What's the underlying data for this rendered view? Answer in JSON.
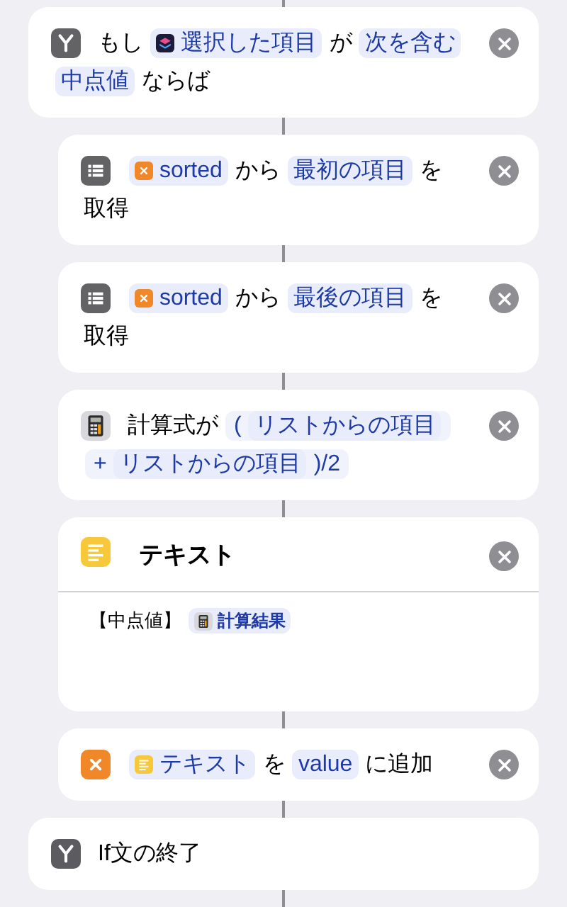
{
  "actions": [
    {
      "kind": "if",
      "removable": true,
      "parts": [
        {
          "kind": "text",
          "text": "もし"
        },
        {
          "kind": "app-token",
          "text": "選択した項目"
        },
        {
          "kind": "text",
          "text": "が"
        },
        {
          "kind": "token",
          "text": "次を含む"
        },
        {
          "kind": "token",
          "text": "中点値"
        },
        {
          "kind": "text",
          "text": "ならば"
        }
      ],
      "children": [
        {
          "kind": "list",
          "removable": true,
          "parts": [
            {
              "kind": "variable-token",
              "text": "sorted"
            },
            {
              "kind": "text",
              "text": "から"
            },
            {
              "kind": "token",
              "text": "最初の項目"
            },
            {
              "kind": "text",
              "text": "を"
            },
            {
              "kind": "text",
              "text": "取得"
            }
          ]
        },
        {
          "kind": "list",
          "removable": true,
          "parts": [
            {
              "kind": "variable-token",
              "text": "sorted"
            },
            {
              "kind": "text",
              "text": "から"
            },
            {
              "kind": "token",
              "text": "最後の項目"
            },
            {
              "kind": "text",
              "text": "を"
            },
            {
              "kind": "text",
              "text": "取得"
            }
          ]
        },
        {
          "kind": "calc",
          "removable": true,
          "parts": [
            {
              "kind": "text",
              "text": "計算式が"
            },
            {
              "kind": "expression",
              "parts": [
                {
                  "kind": "text",
                  "text": "("
                },
                {
                  "kind": "token",
                  "text": "リストからの項目"
                },
                {
                  "kind": "text",
                  "text": "+"
                },
                {
                  "kind": "token",
                  "text": "リストからの項目"
                },
                {
                  "kind": "text",
                  "text": ")/2"
                }
              ]
            }
          ]
        },
        {
          "kind": "text",
          "removable": true,
          "parts": [
            {
              "kind": "text",
              "text": "テキスト"
            }
          ],
          "body": [
            {
              "kind": "text",
              "text": "【中点値】"
            },
            {
              "kind": "calc-token",
              "text": "計算結果"
            }
          ]
        },
        {
          "kind": "variable",
          "removable": true,
          "parts": [
            {
              "kind": "text-token",
              "text": "テキスト"
            },
            {
              "kind": "text",
              "text": "を"
            },
            {
              "kind": "token",
              "text": "value"
            },
            {
              "kind": "text",
              "text": "に追加"
            }
          ]
        }
      ]
    },
    {
      "kind": "endif",
      "removable": false,
      "parts": [
        {
          "kind": "text",
          "text": "If文の終了"
        }
      ]
    }
  ]
}
